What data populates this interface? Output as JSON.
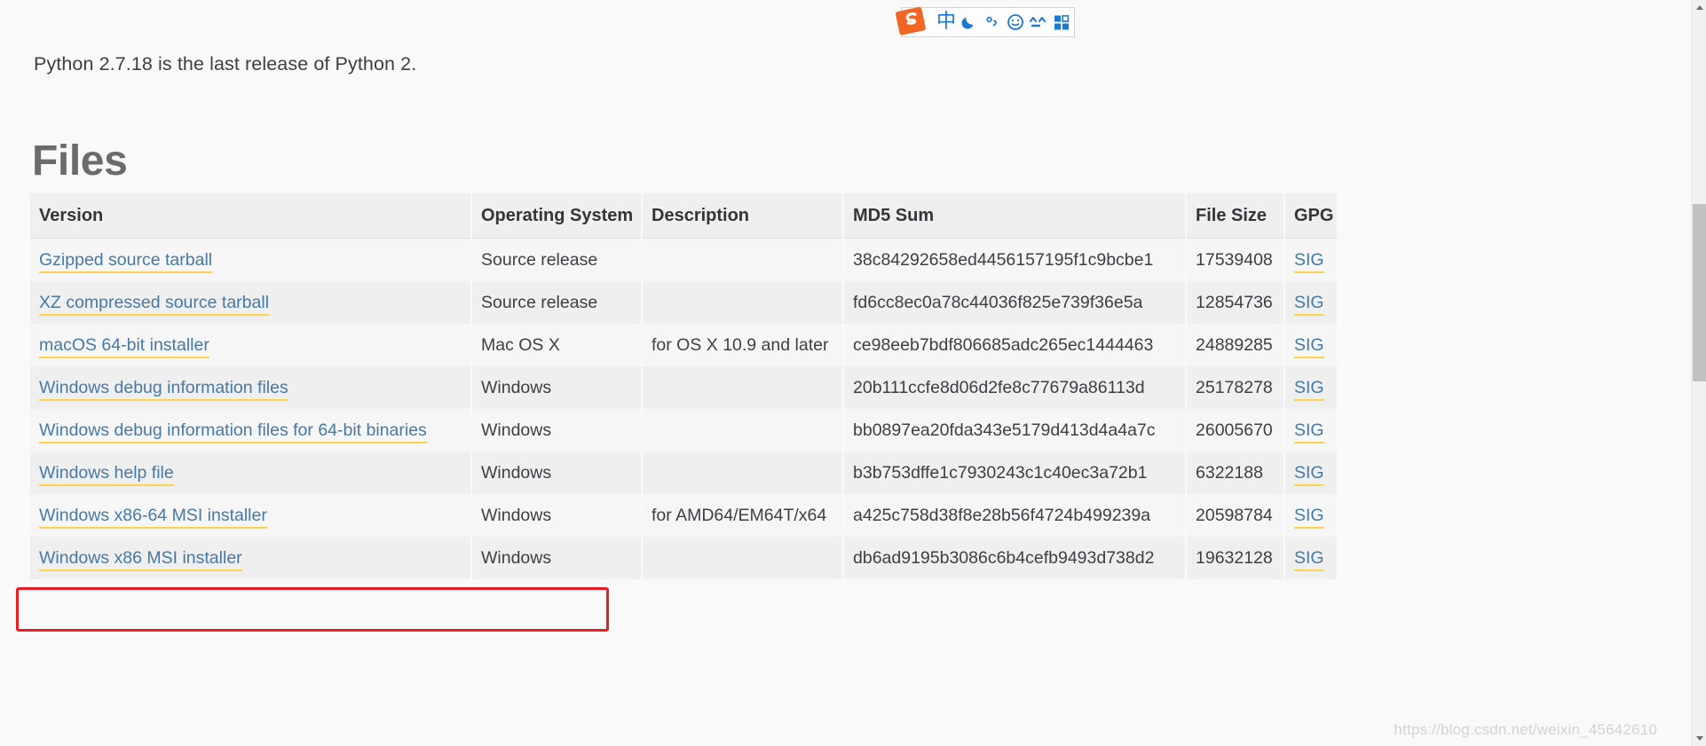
{
  "page": {
    "intro_paragraph": "Python 2.7.18 is the last release of Python 2.",
    "files_heading": "Files",
    "watermark": "https://blog.csdn.net/weixin_45642610"
  },
  "colors": {
    "link": "#4679a8",
    "link_underline": "#ffd24d",
    "annotation_box": "#ec1c24",
    "header_bg": "#efefef",
    "row_odd_bg": "#f6f6f6",
    "row_even_bg": "#efefef",
    "page_bg": "#f9f9f9",
    "heading": "#6b6b6b",
    "ime_accent": "#1b78d0",
    "ime_logo": "#f26522"
  },
  "table": {
    "columns": [
      "Version",
      "Operating System",
      "Description",
      "MD5 Sum",
      "File Size",
      "GPG"
    ],
    "gpg_label": "SIG",
    "rows": [
      {
        "version": "Gzipped source tarball",
        "os": "Source release",
        "description": "",
        "md5": "38c84292658ed4456157195f1c9bcbe1",
        "size": "17539408",
        "gpg": "SIG",
        "highlighted": false
      },
      {
        "version": "XZ compressed source tarball",
        "os": "Source release",
        "description": "",
        "md5": "fd6cc8ec0a78c44036f825e739f36e5a",
        "size": "12854736",
        "gpg": "SIG",
        "highlighted": false
      },
      {
        "version": "macOS 64-bit installer",
        "os": "Mac OS X",
        "description": "for OS X 10.9 and later",
        "md5": "ce98eeb7bdf806685adc265ec1444463",
        "size": "24889285",
        "gpg": "SIG",
        "highlighted": false
      },
      {
        "version": "Windows debug information files",
        "os": "Windows",
        "description": "",
        "md5": "20b111ccfe8d06d2fe8c77679a86113d",
        "size": "25178278",
        "gpg": "SIG",
        "highlighted": false
      },
      {
        "version": "Windows debug information files for 64-bit binaries",
        "os": "Windows",
        "description": "",
        "md5": "bb0897ea20fda343e5179d413d4a4a7c",
        "size": "26005670",
        "gpg": "SIG",
        "highlighted": false
      },
      {
        "version": "Windows help file",
        "os": "Windows",
        "description": "",
        "md5": "b3b753dffe1c7930243c1c40ec3a72b1",
        "size": "6322188",
        "gpg": "SIG",
        "highlighted": false
      },
      {
        "version": "Windows x86-64 MSI installer",
        "os": "Windows",
        "description": "for AMD64/EM64T/x64",
        "md5": "a425c758d38f8e28b56f4724b499239a",
        "size": "20598784",
        "gpg": "SIG",
        "highlighted": true
      },
      {
        "version": "Windows x86 MSI installer",
        "os": "Windows",
        "description": "",
        "md5": "db6ad9195b3086c6b4cefb9493d738d2",
        "size": "19632128",
        "gpg": "SIG",
        "highlighted": false
      }
    ]
  },
  "ime_toolbar": {
    "logo_label": "S",
    "buttons": [
      {
        "name": "chinese-english-toggle-icon",
        "glyph": "中"
      },
      {
        "name": "moon-night-mode-icon",
        "glyph": "moon"
      },
      {
        "name": "punctuation-toggle-icon",
        "glyph": "°,"
      },
      {
        "name": "emoji-smiley-icon",
        "glyph": "smiley"
      },
      {
        "name": "soft-keyboard-icon",
        "glyph": "caret-pair"
      },
      {
        "name": "toolbox-menu-icon",
        "glyph": "grid"
      }
    ]
  },
  "scrollbar": {
    "up_arrow": "▲",
    "down_arrow": "▼"
  }
}
